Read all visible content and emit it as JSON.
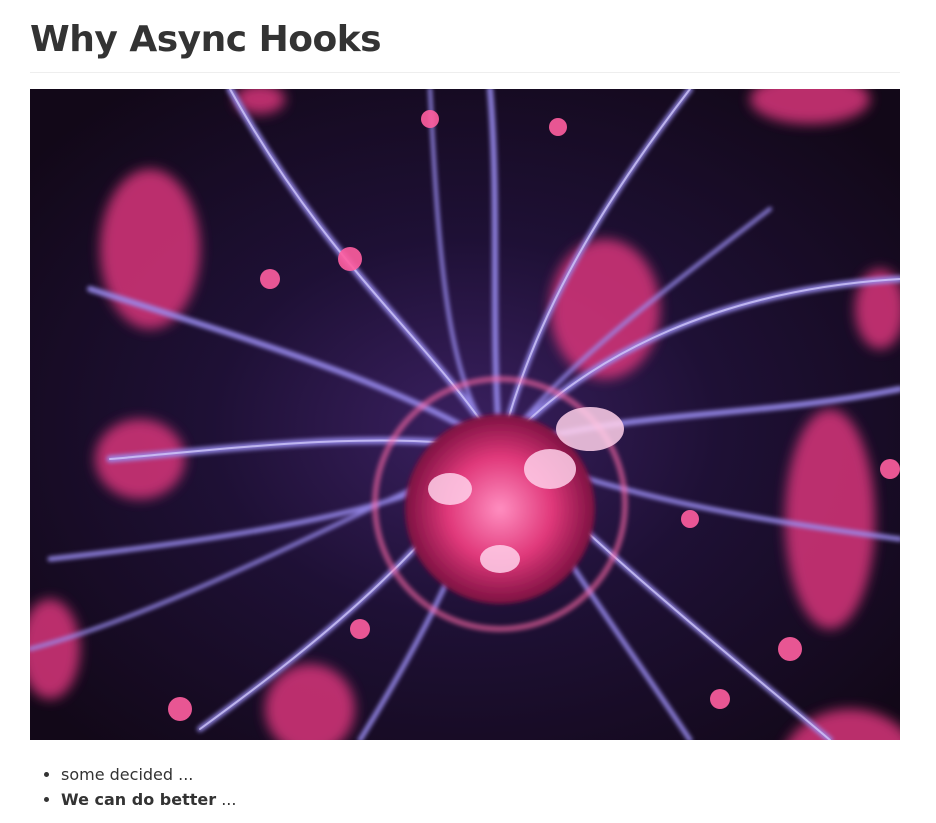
{
  "heading": {
    "title": "Why Async Hooks"
  },
  "image": {
    "icon": "plasma-ball-image"
  },
  "bullets": {
    "item1": {
      "text": "some decided ..."
    },
    "item2": {
      "bold": "We can do better",
      "rest": " ..."
    }
  },
  "colors": {
    "text": "#333333",
    "divider": "#eeeeee",
    "image_bg": "#140a1e",
    "plasma_pink": "#e0387a",
    "plasma_violet": "#9a8cf0"
  }
}
